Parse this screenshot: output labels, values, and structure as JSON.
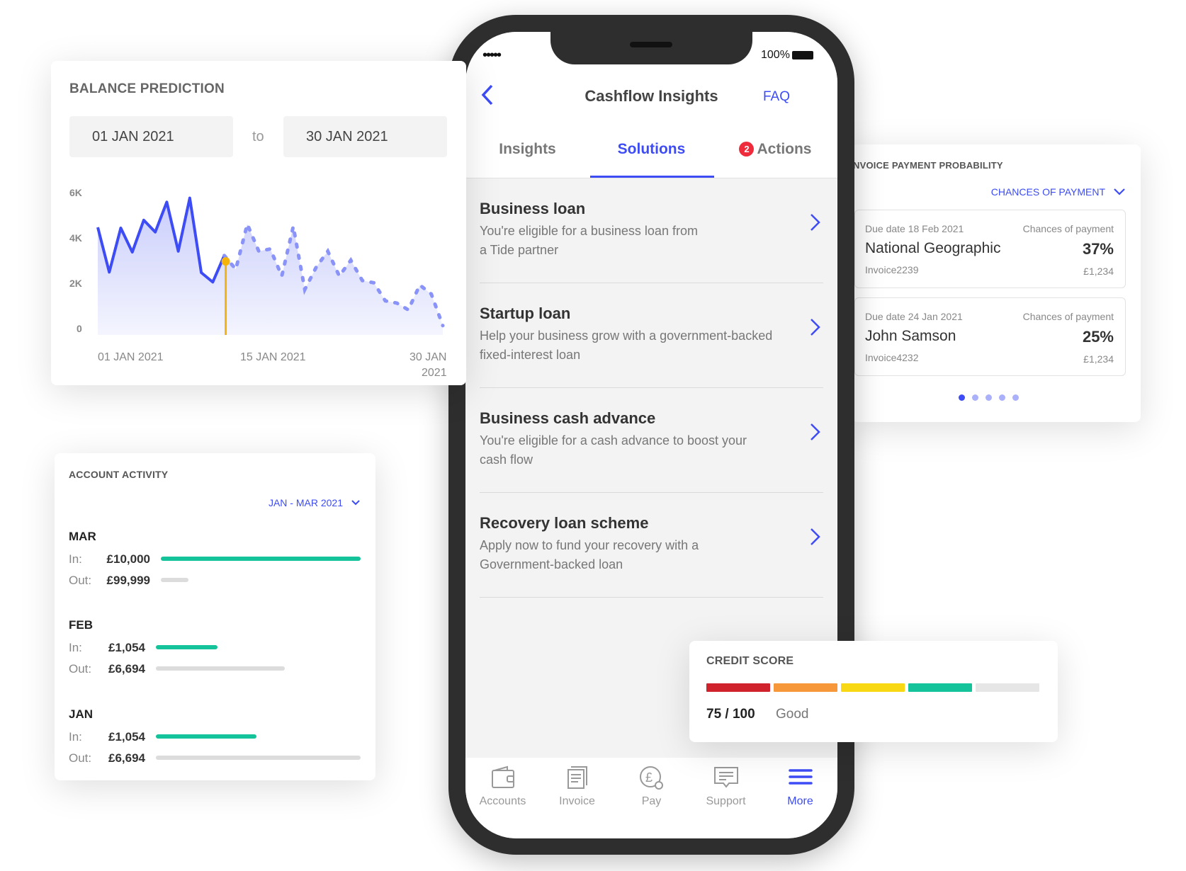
{
  "balance_prediction": {
    "title": "BALANCE PREDICTION",
    "from": "01 JAN 2021",
    "to_label": "to",
    "to": "30 JAN 2021",
    "chart_data": {
      "type": "line",
      "y_ticks": [
        "6K",
        "4K",
        "2K",
        "0"
      ],
      "ylim": [
        0,
        6000
      ],
      "x_ticks": [
        "01 JAN 2021",
        "15 JAN 2021",
        "30 JAN",
        "2021"
      ],
      "values": [
        4460,
        2470,
        4430,
        3360,
        4780,
        4250,
        5580,
        3400,
        5760,
        2450,
        2030,
        3210,
        2600,
        4600,
        3400,
        3500,
        2300,
        4500,
        1700,
        2700,
        3400,
        2300,
        3000,
        2100,
        2000,
        1200,
        1100,
        800,
        1900,
        1500,
        100
      ],
      "actual_count": 12,
      "marker_value": 2950,
      "actual_color": "#3d4cf5",
      "predicted_color": "#8a93f7",
      "marker_color": "#f5b40c"
    }
  },
  "phone": {
    "status": {
      "signal": "•••••",
      "battery": "100%"
    },
    "header": {
      "title": "Cashflow Insights",
      "faq": "FAQ"
    },
    "tabs": [
      {
        "label": "Insights"
      },
      {
        "label": "Solutions",
        "active": true
      },
      {
        "label": "Actions",
        "badge": "2"
      }
    ],
    "items": [
      {
        "title": "Business loan",
        "desc": "You're eligible for a business loan from a Tide partner"
      },
      {
        "title": "Startup loan",
        "desc": "Help your business grow with a government-backed fixed-interest loan"
      },
      {
        "title": "Business cash advance",
        "desc": "You're eligible for a cash advance to boost your cash flow"
      },
      {
        "title": "Recovery loan scheme",
        "desc": "Apply now to fund your recovery with a Government-backed loan"
      }
    ],
    "nav": [
      {
        "label": "Accounts",
        "icon": "wallet-icon"
      },
      {
        "label": "Invoice",
        "icon": "invoice-icon"
      },
      {
        "label": "Pay",
        "icon": "pound-pay-icon"
      },
      {
        "label": "Support",
        "icon": "chat-icon"
      },
      {
        "label": "More",
        "icon": "menu-icon",
        "active": true
      }
    ]
  },
  "account_activity": {
    "title": "ACCOUNT ACTIVITY",
    "range": "JAN - MAR 2021",
    "in_label": "In:",
    "out_label": "Out:",
    "months": [
      {
        "month": "MAR",
        "in": "£10,000",
        "out": "£99,999",
        "in_pct": 100,
        "out_pct": 14
      },
      {
        "month": "FEB",
        "in": "£1,054",
        "out": "£6,694",
        "in_pct": 30,
        "out_pct": 63
      },
      {
        "month": "JAN",
        "in": "£1,054",
        "out": "£6,694",
        "in_pct": 49,
        "out_pct": 100
      }
    ]
  },
  "invoice": {
    "title": "NVOICE PAYMENT PROBABILITY",
    "sort": "CHANCES OF PAYMENT",
    "cards": [
      {
        "due": "Due date  18 Feb 2021",
        "chance_label": "Chances of payment",
        "name": "National Geographic",
        "pct": "37%",
        "ref": "Invoice2239",
        "amount": "£1,234"
      },
      {
        "due": "Due date  24 Jan 2021",
        "chance_label": "Chances of payment",
        "name": "John Samson",
        "pct": "25%",
        "ref": "Invoice4232",
        "amount": "£1,234"
      }
    ],
    "pages": 5,
    "active_page": 1
  },
  "credit_score": {
    "title": "CREDIT SCORE",
    "score": "75 / 100",
    "rating": "Good",
    "level": 75,
    "colors": [
      "#d0222c",
      "#f6983a",
      "#f7d812",
      "#14c39a",
      "#e6e6e6"
    ]
  }
}
